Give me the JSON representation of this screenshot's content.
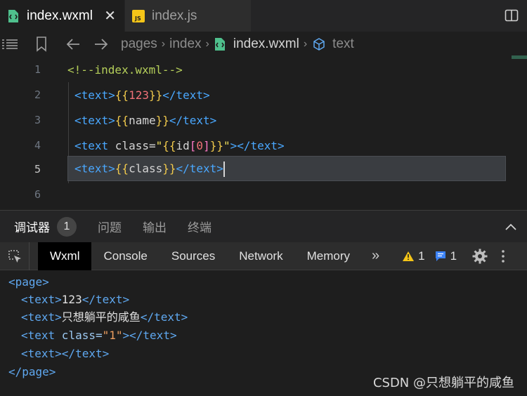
{
  "tabs": [
    {
      "label": "index.wxml",
      "active": true
    },
    {
      "label": "index.js",
      "active": false
    }
  ],
  "tab_close_glyph": "✕",
  "breadcrumb": {
    "items": [
      "pages",
      "index",
      "index.wxml",
      "text"
    ]
  },
  "editor": {
    "line_numbers": [
      "1",
      "2",
      "3",
      "4",
      "5",
      "6"
    ],
    "current_line": "5",
    "line1": {
      "comment": "<!--index.wxml-->"
    },
    "line2": {
      "open": "<text>",
      "b1": "{{",
      "value": "123",
      "b2": "}}",
      "close": "</text>"
    },
    "line3": {
      "open": "<text>",
      "b1": "{{",
      "value": "name",
      "b2": "}}",
      "close": "</text>"
    },
    "line4": {
      "open": "<text",
      "attr": " class=",
      "q1": "\"",
      "b1": "{{",
      "ident": "id",
      "br1": "[",
      "idx": "0",
      "br2": "]",
      "b2": "}}",
      "q2": "\"",
      "close": "></text>"
    },
    "line5": {
      "open": "<text>",
      "b1": "{{",
      "value": "class",
      "b2": "}}",
      "close": "</text>"
    }
  },
  "panel": {
    "tabs": [
      {
        "label": "调试器",
        "active": true
      },
      {
        "label": "问题",
        "active": false
      },
      {
        "label": "输出",
        "active": false
      },
      {
        "label": "终端",
        "active": false
      }
    ],
    "badge": "1"
  },
  "devtools": {
    "tabs": [
      {
        "label": "Wxml",
        "active": true
      },
      {
        "label": "Console",
        "active": false
      },
      {
        "label": "Sources",
        "active": false
      },
      {
        "label": "Network",
        "active": false
      },
      {
        "label": "Memory",
        "active": false
      }
    ],
    "more": "»",
    "warnings": "1",
    "messages": "1"
  },
  "tree": {
    "root_open": "<page>",
    "root_close": "</page>",
    "rows": [
      {
        "open": "<text>",
        "content": "123",
        "close": "</text>"
      },
      {
        "open": "<text>",
        "content": "只想躺平的咸鱼",
        "close": "</text>"
      },
      {
        "open": "<text",
        "attr": " class=",
        "value": "\"1\"",
        "close": "></text>"
      },
      {
        "open": "<text>",
        "content": "",
        "close": "</text>"
      }
    ]
  },
  "watermark": "CSDN @只想躺平的咸鱼",
  "colors": {
    "tag": "#4aa8ff",
    "wxml_icon": "#4fc08d",
    "js_icon": "#f5c518",
    "warning": "#f5c518",
    "message": "#3b82f6"
  }
}
